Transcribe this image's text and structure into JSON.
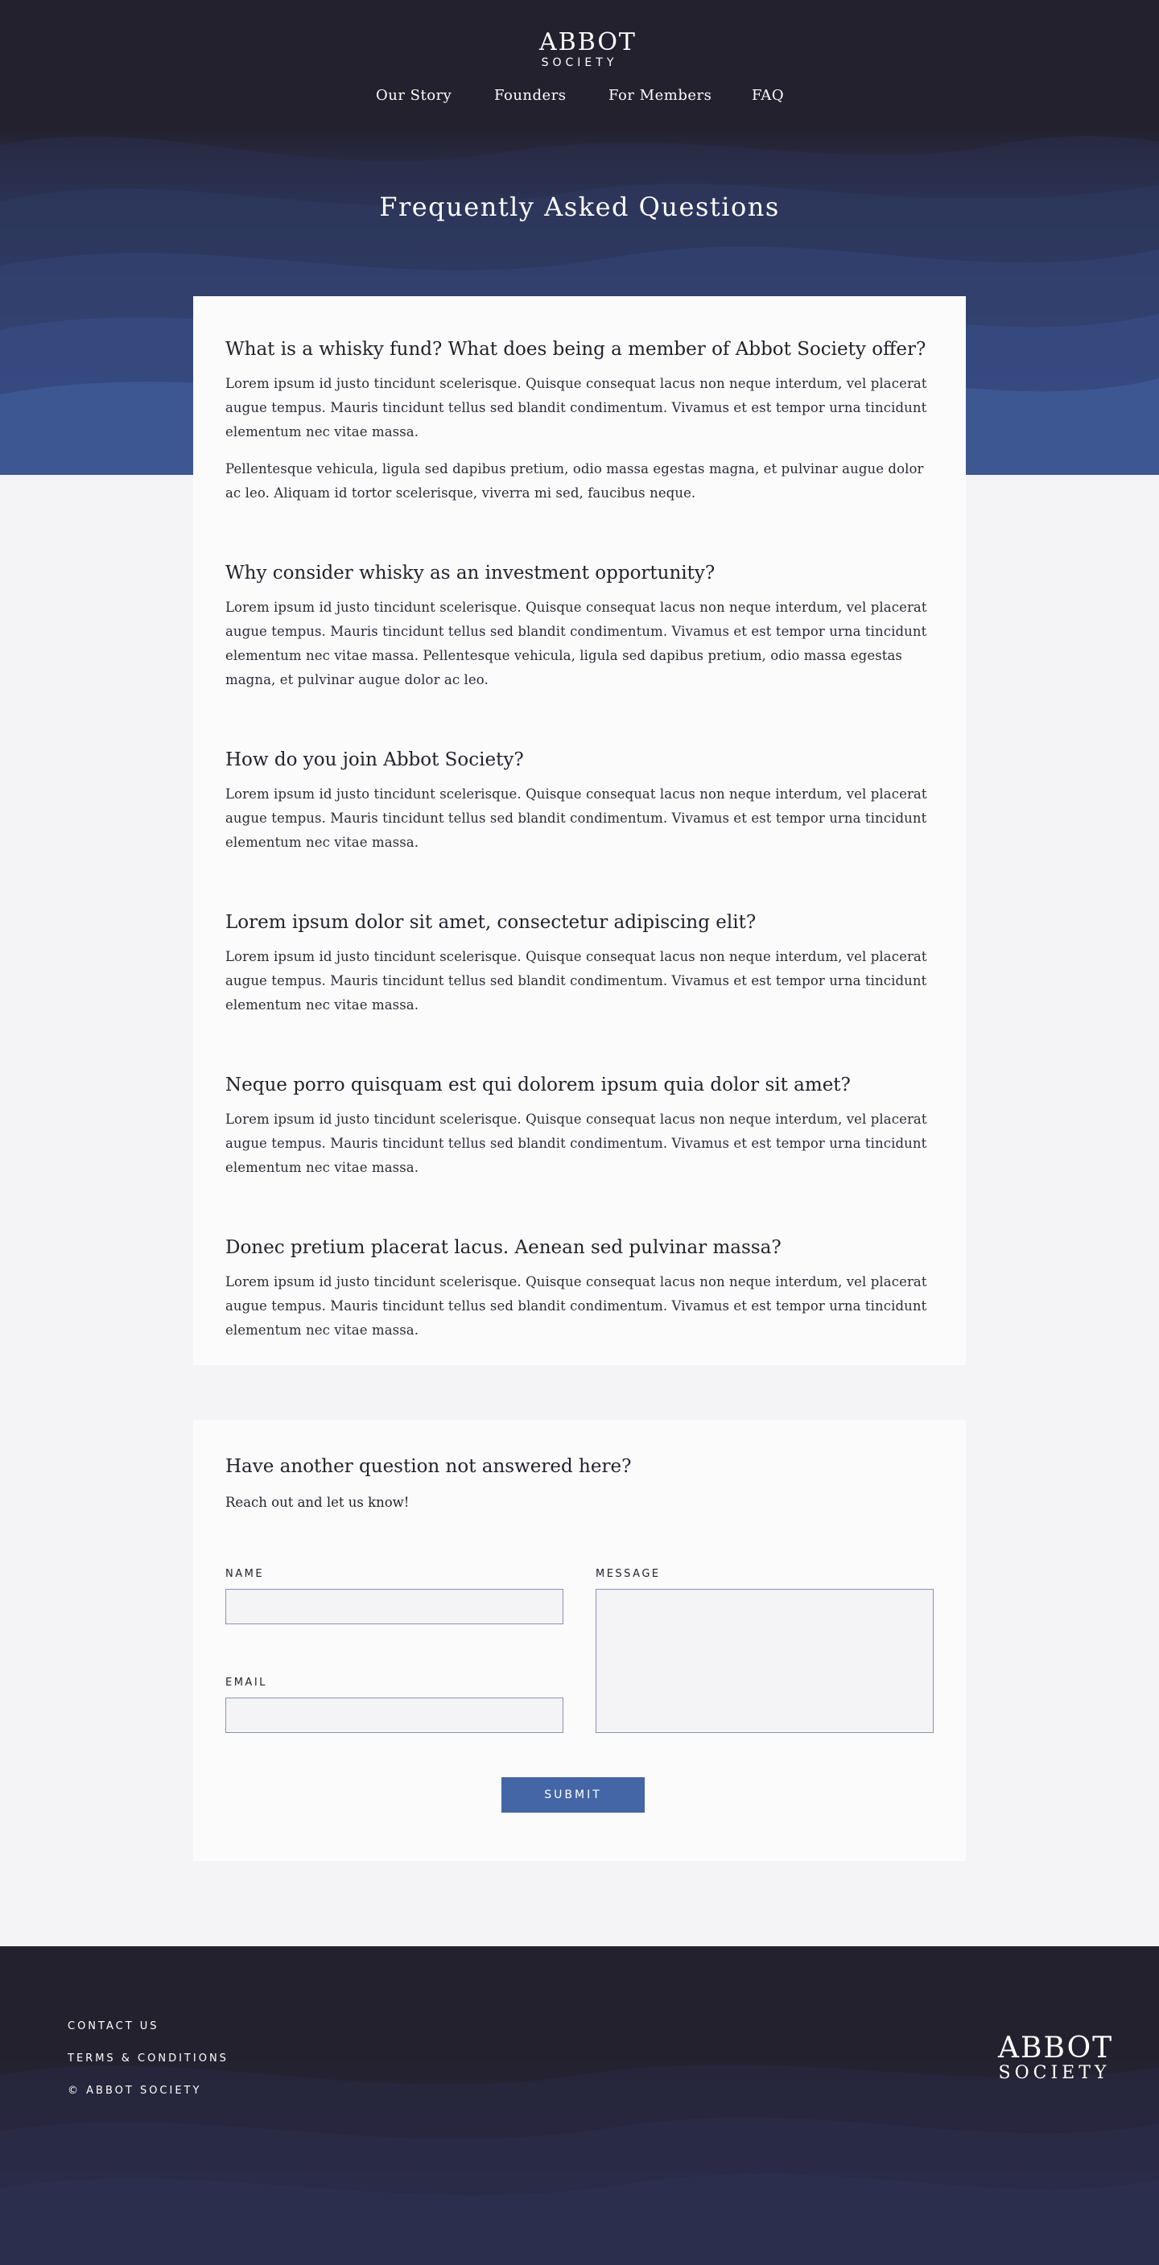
{
  "brand": {
    "line1": "ABBOT",
    "line2": "SOCIETY"
  },
  "nav": {
    "items": [
      {
        "label": "Our Story"
      },
      {
        "label": "Founders"
      },
      {
        "label": "For Members"
      },
      {
        "label": "FAQ"
      }
    ]
  },
  "hero": {
    "title": "Frequently Asked Questions"
  },
  "faq": {
    "items": [
      {
        "question": "What is a whisky fund? What does being a member of Abbot Society offer?",
        "answers": [
          "Lorem ipsum id justo tincidunt scelerisque. Quisque consequat lacus non neque interdum, vel placerat augue tempus. Mauris tincidunt tellus sed blandit condimentum. Vivamus et est tempor urna tincidunt elementum nec vitae massa.",
          "Pellentesque vehicula, ligula sed dapibus pretium, odio massa egestas magna, et pulvinar augue dolor ac leo. Aliquam id tortor scelerisque, viverra mi sed, faucibus neque."
        ]
      },
      {
        "question": "Why consider whisky as an investment opportunity?",
        "answers": [
          "Lorem ipsum id justo tincidunt scelerisque. Quisque consequat lacus non neque interdum, vel placerat augue tempus. Mauris tincidunt tellus sed blandit condimentum. Vivamus et est tempor urna tincidunt elementum nec vitae massa. Pellentesque vehicula, ligula sed dapibus pretium, odio massa egestas magna, et pulvinar augue dolor ac leo."
        ]
      },
      {
        "question": "How do you join Abbot Society?",
        "answers": [
          "Lorem ipsum id justo tincidunt scelerisque. Quisque consequat lacus non neque interdum, vel placerat augue tempus. Mauris tincidunt tellus sed blandit condimentum. Vivamus et est tempor urna tincidunt elementum nec vitae massa."
        ]
      },
      {
        "question": "Lorem ipsum dolor sit amet, consectetur adipiscing elit?",
        "answers": [
          "Lorem ipsum id justo tincidunt scelerisque. Quisque consequat lacus non neque interdum, vel placerat augue tempus. Mauris tincidunt tellus sed blandit condimentum. Vivamus et est tempor urna tincidunt elementum nec vitae massa."
        ]
      },
      {
        "question": "Neque porro quisquam est qui dolorem ipsum quia dolor sit amet?",
        "answers": [
          "Lorem ipsum id justo tincidunt scelerisque. Quisque consequat lacus non neque interdum, vel placerat augue tempus. Mauris tincidunt tellus sed blandit condimentum. Vivamus et est tempor urna tincidunt elementum nec vitae massa."
        ]
      },
      {
        "question": "Donec pretium placerat lacus. Aenean sed pulvinar massa?",
        "answers": [
          "Lorem ipsum id justo tincidunt scelerisque. Quisque consequat lacus non neque interdum, vel placerat augue tempus. Mauris tincidunt tellus sed blandit condimentum. Vivamus et est tempor urna tincidunt elementum nec vitae massa."
        ]
      }
    ]
  },
  "contact": {
    "heading": "Have another question not answered here?",
    "subheading": "Reach out and let us know!",
    "name_label": "NAME",
    "name_value": "",
    "email_label": "EMAIL",
    "email_value": "",
    "message_label": "MESSAGE",
    "message_value": "",
    "submit_label": "SUBMIT"
  },
  "footer": {
    "links": [
      {
        "label": "CONTACT US"
      },
      {
        "label": "TERMS & CONDITIONS"
      },
      {
        "label": "© ABBOT SOCIETY"
      }
    ]
  },
  "colors": {
    "dark": "#24212f",
    "accent": "#4465a6",
    "card": "#fbfbfc",
    "page": "#f4f4f6"
  }
}
